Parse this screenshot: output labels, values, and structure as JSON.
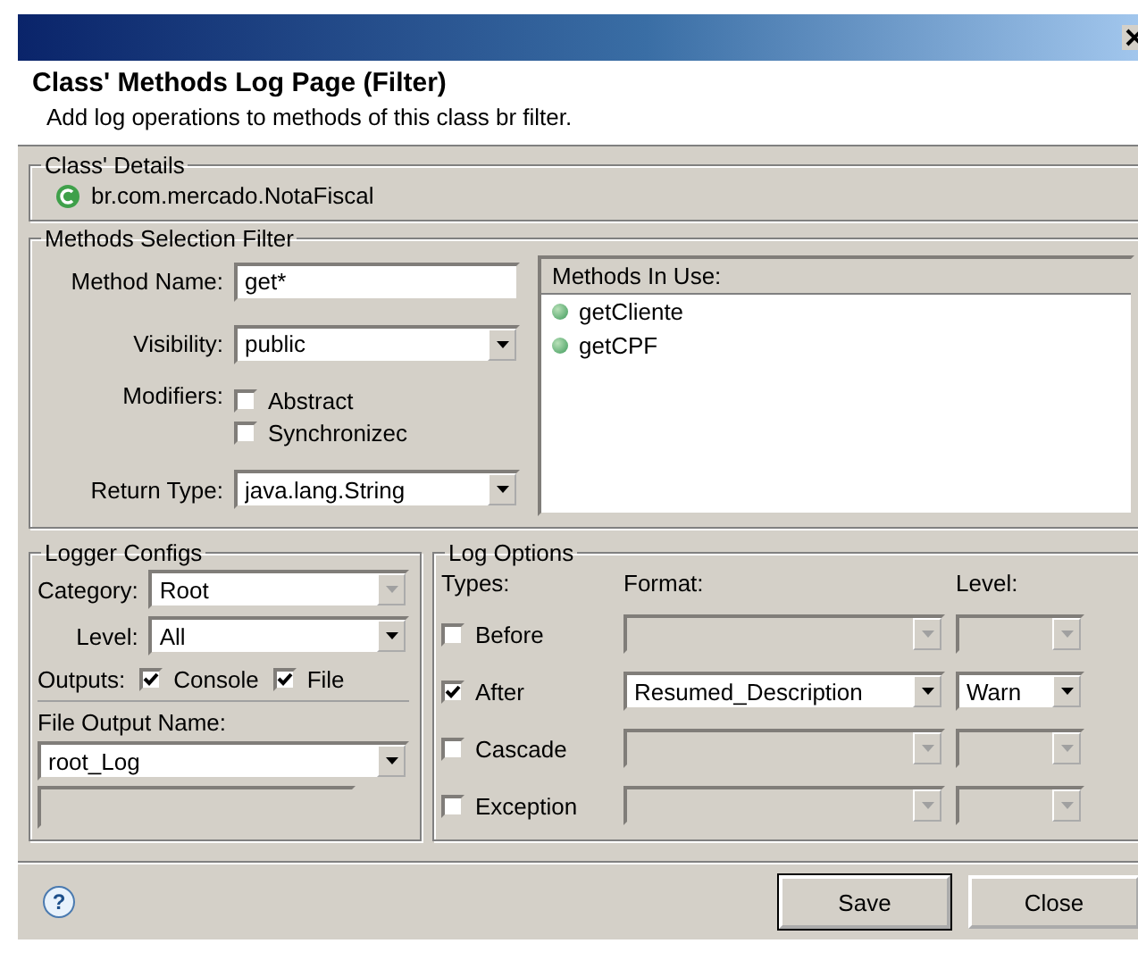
{
  "header": {
    "title": "Class' Methods Log Page (Filter)",
    "description": "Add log operations to methods of this class br filter."
  },
  "class_details": {
    "legend": "Class' Details",
    "class_name": "br.com.mercado.NotaFiscal"
  },
  "methods_filter": {
    "legend": "Methods Selection Filter",
    "method_name": {
      "label": "Method Name:",
      "value": "get*"
    },
    "visibility": {
      "label": "Visibility:",
      "value": "public",
      "disabled": false
    },
    "modifiers": {
      "label": "Modifiers:",
      "options": [
        {
          "label": "Abstract",
          "checked": false
        },
        {
          "label": "Synchronizec",
          "checked": false
        }
      ]
    },
    "return_type": {
      "label": "Return Type:",
      "value": "java.lang.String",
      "disabled": false
    },
    "methods_in_use": {
      "header": "Methods In Use:",
      "items": [
        "getCliente",
        "getCPF"
      ]
    }
  },
  "logger_configs": {
    "legend": "Logger Configs",
    "category": {
      "label": "Category:",
      "value": "Root",
      "disabled": true
    },
    "level": {
      "label": "Level:",
      "value": "All",
      "disabled": false
    },
    "outputs": {
      "label": "Outputs:",
      "options": [
        {
          "label": "Console",
          "checked": true
        },
        {
          "label": "File",
          "checked": true
        }
      ]
    },
    "file_output": {
      "label": "File Output Name:",
      "value": "root_Log",
      "disabled": false
    },
    "extra_field": {
      "disabled": true
    }
  },
  "log_options": {
    "legend": "Log Options",
    "columns": [
      "Types:",
      "Format:",
      "Level:"
    ],
    "rows": [
      {
        "type": "Before",
        "checked": false,
        "format": {
          "disabled": true
        },
        "level": {
          "disabled": true
        }
      },
      {
        "type": "After",
        "checked": true,
        "format": {
          "value": "Resumed_Description",
          "disabled": false
        },
        "level": {
          "value": "Warn",
          "disabled": false
        }
      },
      {
        "type": "Cascade",
        "checked": false,
        "format": {
          "disabled": true
        },
        "level": {
          "disabled": true
        }
      },
      {
        "type": "Exception",
        "checked": false,
        "format": {
          "disabled": true
        },
        "level": {
          "disabled": true
        }
      }
    ]
  },
  "footer": {
    "help": "?",
    "buttons": [
      "Save",
      "Close"
    ]
  }
}
